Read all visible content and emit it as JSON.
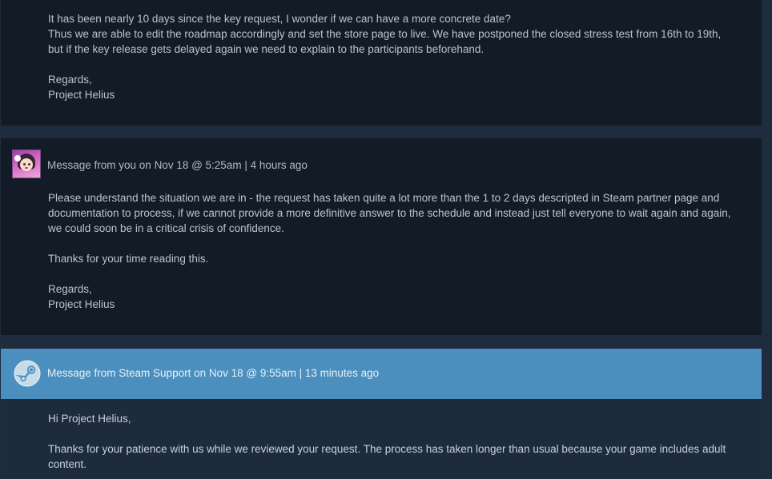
{
  "colors": {
    "page_bg": "#1e2c3d",
    "message_bg": "#131c26",
    "support_header_bg": "#4a8fbd",
    "support_body_bg": "#1e2b3d",
    "text": "#b8c4d0"
  },
  "messages": [
    {
      "paragraphs": [
        "It has been nearly 10 days since the key request, I wonder if we can have a more concrete date?",
        "Thus we are able to edit the roadmap accordingly and set the store page to live. We have postponed the closed stress test from 16th to 19th, but if the key release gets delayed again we need to explain to the participants beforehand.",
        "",
        "Regards,",
        "Project Helius"
      ]
    },
    {
      "avatar_icon": "anime-girl-avatar",
      "header": "Message from you on Nov 18 @ 5:25am | 4 hours ago",
      "paragraphs": [
        "Please understand the situation we are in - the request has taken quite a lot more than the 1 to 2 days descripted in Steam partner page and documentation to process, if we cannot provide a more definitive answer to the schedule and instead just tell everyone to wait again and again, we could soon be in a critical crisis of confidence.",
        "",
        "Thanks for your time reading this.",
        "",
        "Regards,",
        "Project Helius"
      ]
    },
    {
      "avatar_icon": "steam-logo-icon",
      "header": "Message from Steam Support on Nov 18 @ 9:55am | 13 minutes ago",
      "paragraphs": [
        "Hi Project Helius,",
        "",
        "Thanks for your patience with us while we reviewed your request. The process has taken longer than usual because your game includes adult content."
      ]
    }
  ]
}
